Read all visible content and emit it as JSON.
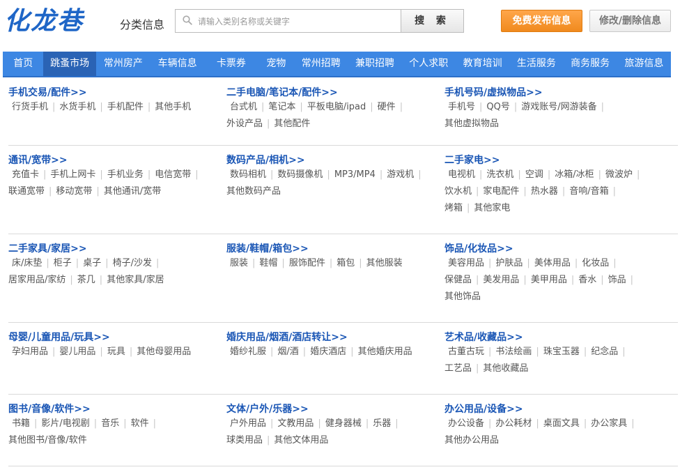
{
  "header": {
    "logo_text": "化龙巷",
    "logo_sub": "分类信息",
    "search_placeholder": "请输入类别名称或关键字",
    "search_button": "搜 索",
    "publish_button": "免费发布信息",
    "edit_button": "修改/删除信息"
  },
  "nav": {
    "items": [
      "首页",
      "跳蚤市场",
      "常州房产",
      "车辆信息",
      "卡票券",
      "宠物",
      "常州招聘",
      "兼职招聘",
      "个人求职",
      "教育培训",
      "生活服务",
      "商务服务",
      "旅游信息"
    ],
    "active_index": 1
  },
  "colors": {
    "nav_bg": "#3d87e3",
    "nav_active": "#2a63b5",
    "title_blue": "#1a56b5",
    "publish_orange": "#f39a34"
  },
  "categories": [
    [
      {
        "title": "手机交易/配件>>",
        "links": [
          "行货手机",
          "水货手机",
          "手机配件",
          "其他手机"
        ]
      },
      {
        "title": "二手电脑/笔记本/配件>>",
        "links": [
          "台式机",
          "笔记本",
          "平板电脑/ipad",
          "硬件",
          "外设产品",
          "其他配件"
        ]
      },
      {
        "title": "手机号码/虚拟物品>>",
        "links": [
          "手机号",
          "QQ号",
          "游戏账号/网游装备",
          "其他虚拟物品"
        ]
      }
    ],
    [
      {
        "title": "通讯/宽带>>",
        "links": [
          "充值卡",
          "手机上网卡",
          "手机业务",
          "电信宽带",
          "联通宽带",
          "移动宽带",
          "其他通讯/宽带"
        ]
      },
      {
        "title": "数码产品/相机>>",
        "links": [
          "数码相机",
          "数码摄像机",
          "MP3/MP4",
          "游戏机",
          "其他数码产品"
        ]
      },
      {
        "title": "二手家电>>",
        "links": [
          "电视机",
          "洗衣机",
          "空调",
          "冰箱/冰柜",
          "微波炉",
          "饮水机",
          "家电配件",
          "热水器",
          "音响/音箱",
          "烤箱",
          "其他家电"
        ]
      }
    ],
    [
      {
        "title": "二手家具/家居>>",
        "links": [
          "床/床垫",
          "柜子",
          "桌子",
          "椅子/沙发",
          "居家用品/家纺",
          "茶几",
          "其他家具/家居"
        ]
      },
      {
        "title": "服装/鞋帽/箱包>>",
        "links": [
          "服装",
          "鞋帽",
          "服饰配件",
          "箱包",
          "其他服装"
        ]
      },
      {
        "title": "饰品/化妆品>>",
        "links": [
          "美容用品",
          "护肤品",
          "美体用品",
          "化妆品",
          "保健品",
          "美发用品",
          "美甲用品",
          "香水",
          "饰品",
          "其他饰品"
        ]
      }
    ],
    [
      {
        "title": "母婴/儿童用品/玩具>>",
        "links": [
          "孕妇用品",
          "婴儿用品",
          "玩具",
          "其他母婴用品"
        ]
      },
      {
        "title": "婚庆用品/烟酒/酒店转让>>",
        "links": [
          "婚纱礼服",
          "烟/酒",
          "婚庆酒店",
          "其他婚庆用品"
        ]
      },
      {
        "title": "艺术品/收藏品>>",
        "links": [
          "古董古玩",
          "书法绘画",
          "珠宝玉器",
          "纪念品",
          "工艺品",
          "其他收藏品"
        ]
      }
    ],
    [
      {
        "title": "图书/音像/软件>>",
        "links": [
          "书籍",
          "影片/电视剧",
          "音乐",
          "软件",
          "其他图书/音像/软件"
        ]
      },
      {
        "title": "文体/户外/乐器>>",
        "links": [
          "户外用品",
          "文教用品",
          "健身器械",
          "乐器",
          "球类用品",
          "其他文体用品"
        ]
      },
      {
        "title": "办公用品/设备>>",
        "links": [
          "办公设备",
          "办公耗材",
          "桌面文具",
          "办公家具",
          "其他办公用品"
        ]
      }
    ]
  ]
}
